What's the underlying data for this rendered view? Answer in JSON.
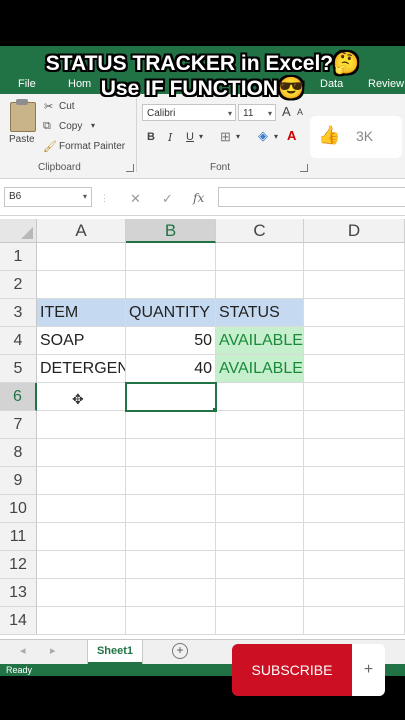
{
  "overlay": {
    "caption_line1": "STATUS TRACKER in Excel?",
    "caption_line1_emoji": "🤔",
    "caption_line2": "Use IF FUNCTION",
    "caption_line2_emoji": "😎",
    "subscribe_label": "SUBSCRIBE",
    "plus_label": "+"
  },
  "ribbon": {
    "tabs": [
      "File",
      "Hom",
      "Data",
      "Review"
    ],
    "clipboard": {
      "paste": "Paste",
      "cut": "Cut",
      "copy": "Copy",
      "format_painter": "Format Painter",
      "group_label": "Clipboard"
    },
    "font": {
      "family": "Calibri",
      "size": "11",
      "bold": "B",
      "italic": "I",
      "underline": "U",
      "group_label": "Font",
      "grow": "A",
      "shrink": "A"
    },
    "like": {
      "icon": "thumbs-up-icon",
      "count": "3K"
    }
  },
  "formula_bar": {
    "name_box": "B6",
    "cancel": "✕",
    "enter": "✓",
    "fx": "fx",
    "value": ""
  },
  "grid": {
    "columns": [
      "A",
      "B",
      "C",
      "D"
    ],
    "selected_column": "B",
    "rows": [
      "1",
      "2",
      "3",
      "4",
      "5",
      "6",
      "7",
      "8",
      "9",
      "10",
      "11",
      "12",
      "13",
      "14"
    ],
    "selected_row": "6",
    "cells": {
      "A3": "ITEM",
      "B3": "QUANTITY",
      "C3": "STATUS",
      "A4": "SOAP",
      "B4": "50",
      "C4": "AVAILABLE",
      "A5": "DETERGEN",
      "B5": "40",
      "C5": "AVAILABLE"
    },
    "active_cell": "B6"
  },
  "sheets": {
    "tabs": [
      "Sheet1"
    ],
    "add": "+",
    "status": "Ready"
  },
  "colors": {
    "excel_green": "#217346",
    "header_fill": "#c5d9f1",
    "available_fill": "#c6efce",
    "available_text": "#1a8a3a",
    "subscribe_red": "#cc0f22"
  }
}
